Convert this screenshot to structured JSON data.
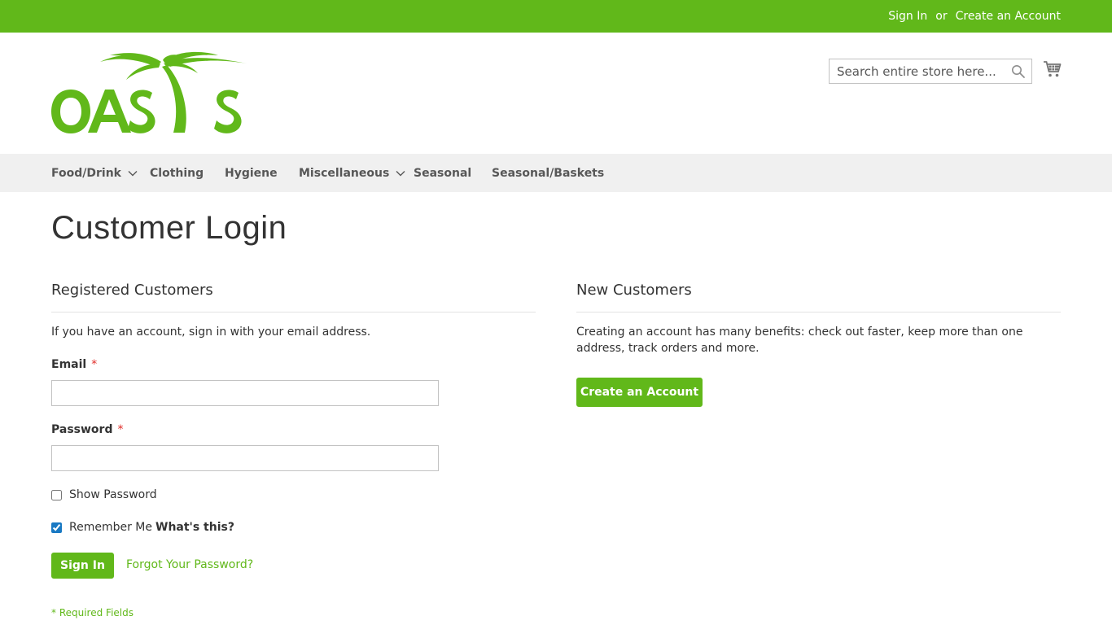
{
  "topbar": {
    "sign_in": "Sign In",
    "or": "or",
    "create_account": "Create an Account"
  },
  "brand": {
    "logo_text": "OASIS",
    "accent_color": "#61b81a"
  },
  "search": {
    "placeholder": "Search entire store here...",
    "icon": "search-icon"
  },
  "cart": {
    "icon": "cart-icon"
  },
  "nav": {
    "items": [
      {
        "label": "Food/Drink",
        "has_dropdown": true
      },
      {
        "label": "Clothing",
        "has_dropdown": false
      },
      {
        "label": "Hygiene",
        "has_dropdown": false
      },
      {
        "label": "Miscellaneous",
        "has_dropdown": true
      },
      {
        "label": "Seasonal",
        "has_dropdown": false
      },
      {
        "label": "Seasonal/Baskets",
        "has_dropdown": false
      }
    ]
  },
  "page": {
    "title": "Customer Login"
  },
  "registered": {
    "title": "Registered Customers",
    "note": "If you have an account, sign in with your email address.",
    "email_label": "Email",
    "email_value": "",
    "password_label": "Password",
    "password_value": "",
    "required_mark": "*",
    "show_password_label": "Show Password",
    "show_password_checked": false,
    "remember_me_label": "Remember Me",
    "remember_me_checked": true,
    "whats_this": "What's this?",
    "sign_in_button": "Sign In",
    "forgot_link": "Forgot Your Password?",
    "required_fields_note": "* Required Fields"
  },
  "new_customers": {
    "title": "New Customers",
    "note": "Creating an account has many benefits: check out faster, keep more than one address, track orders and more.",
    "create_button": "Create an Account"
  }
}
